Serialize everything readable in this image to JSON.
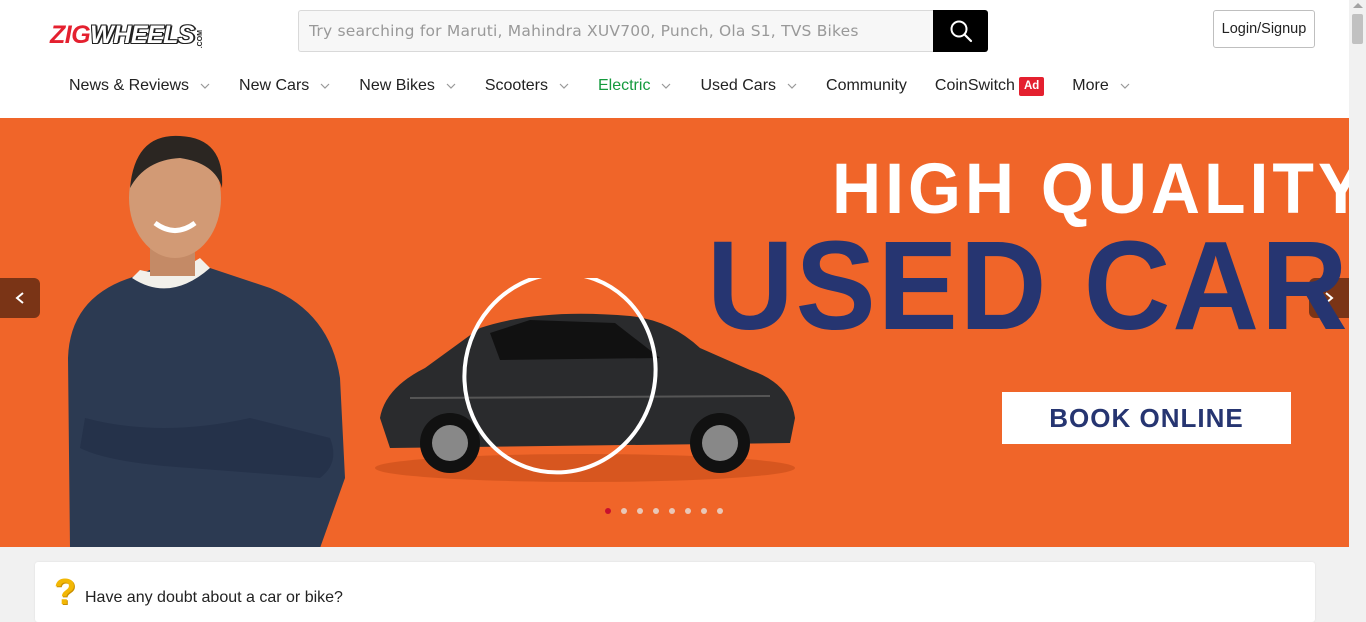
{
  "header": {
    "logo": {
      "primary": "ZIG",
      "secondary": "WHEELS",
      "suffix": ".COM"
    },
    "search": {
      "placeholder": "Try searching for Maruti, Mahindra XUV700, Punch, Ola S1, TVS Bikes",
      "value": "",
      "button_icon": "search-icon"
    },
    "login_label": "Login/Signup"
  },
  "nav": {
    "items": [
      {
        "label": "News & Reviews",
        "has_dropdown": true
      },
      {
        "label": "New Cars",
        "has_dropdown": true
      },
      {
        "label": "New Bikes",
        "has_dropdown": true
      },
      {
        "label": "Scooters",
        "has_dropdown": true
      },
      {
        "label": "Electric",
        "has_dropdown": true,
        "color": "#149a3d"
      },
      {
        "label": "Used Cars",
        "has_dropdown": true
      },
      {
        "label": "Community",
        "has_dropdown": false
      },
      {
        "label": "CoinSwitch",
        "has_dropdown": false,
        "badge": "Ad"
      },
      {
        "label": "More",
        "has_dropdown": true
      }
    ]
  },
  "banner": {
    "headline_1": "HIGH QUALITY",
    "headline_2": "USED CARS",
    "cta_label": "BOOK ONLINE",
    "prev_icon": "chevron-left-icon",
    "next_icon": "chevron-right-icon",
    "slide_count": 8,
    "active_slide": 1,
    "colors": {
      "background": "#f06529",
      "headline_2": "#263571",
      "cta_text": "#263571"
    }
  },
  "question_card": {
    "title": "Have any doubt about a car or bike?",
    "icon": "question-mark-icon"
  },
  "colors": {
    "brand_red": "#e4202f",
    "electric_green": "#149a3d"
  }
}
